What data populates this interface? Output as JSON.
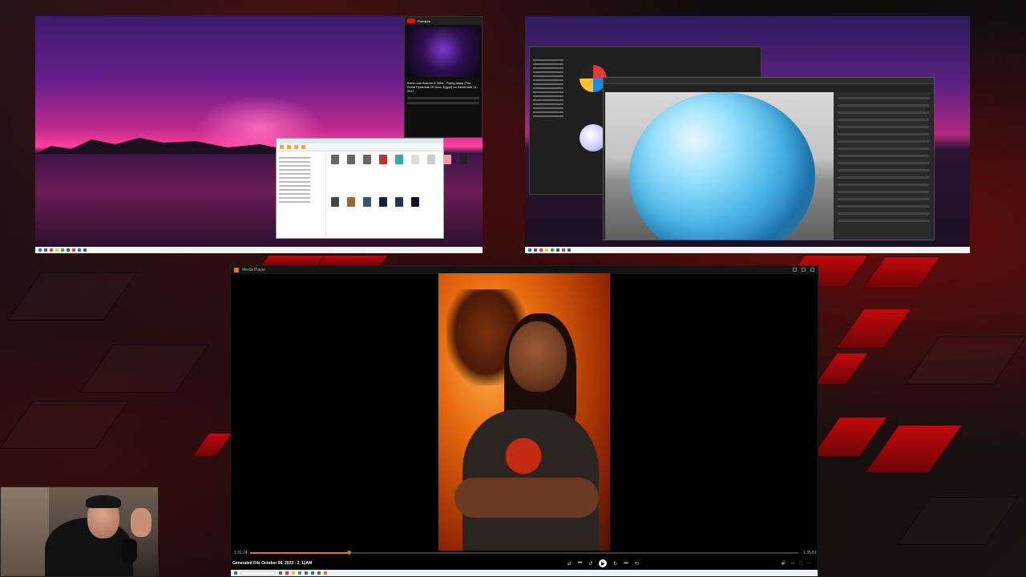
{
  "monitor1": {
    "youtube": {
      "brand": "Premium",
      "video_title": "Armin van Buuren & Nifra - Flying Away (The Great Pyramids Of Giza, Egypt) on December 11, 2017"
    }
  },
  "media_player": {
    "window_title": "Media Player",
    "file_name": "Generated File October 08, 2023 - 2_11AM",
    "time_elapsed": "1:31:24",
    "time_total": "1:35:01",
    "progress_fraction": 0.18
  },
  "colors": {
    "accent_orange": "#e46f27",
    "youtube_red": "#ff0000"
  }
}
